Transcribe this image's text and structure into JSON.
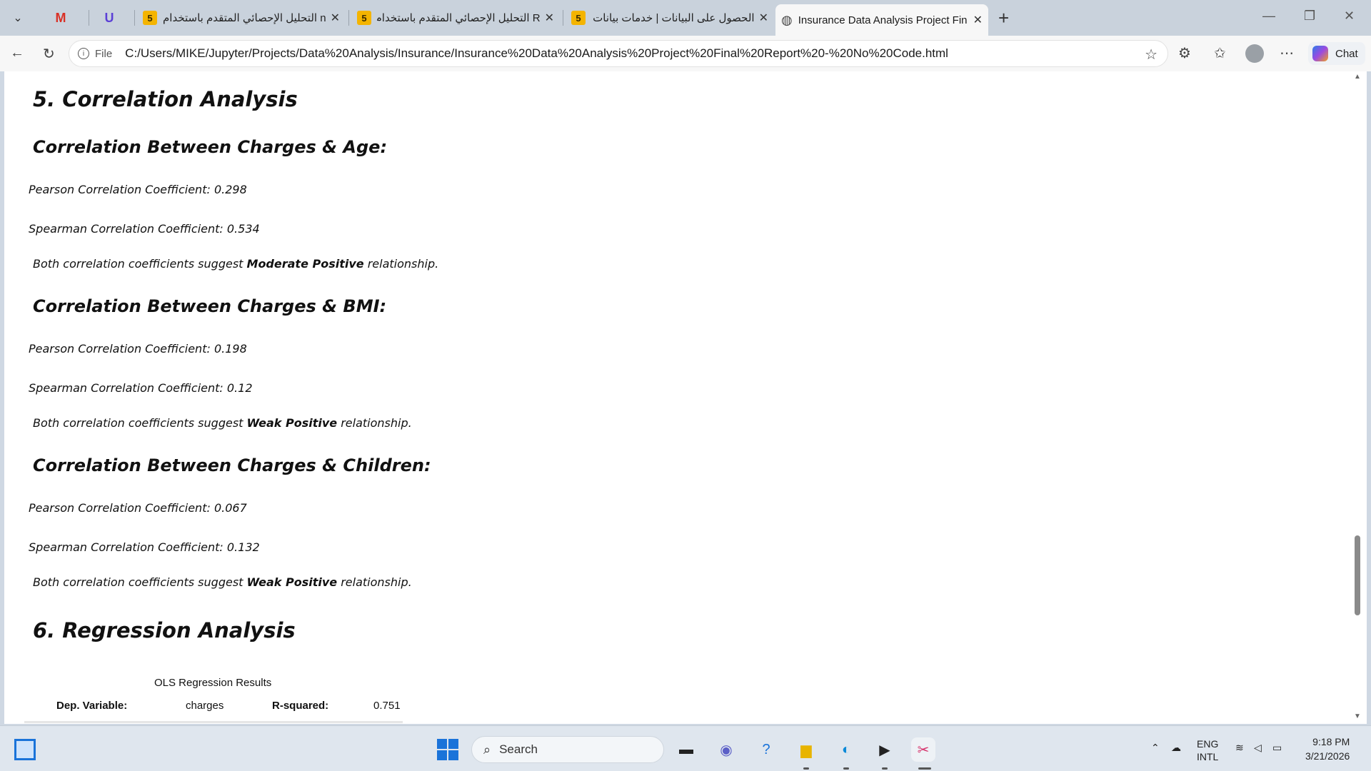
{
  "browser": {
    "pinned": [
      "M",
      "U"
    ],
    "tabs": [
      {
        "badge": "5",
        "title": "n التحليل الإحصائي المتقدم باستخدام"
      },
      {
        "badge": "5",
        "title": "R التحليل الإحصائي المتقدم باستخدام"
      },
      {
        "badge": "5",
        "title": "الحصول على البيانات | خدمات بيانات"
      },
      {
        "badge": "",
        "title": "Insurance Data Analysis Project Fin"
      }
    ],
    "protocol": "File",
    "url": "C:/Users/MIKE/Jupyter/Projects/Data%20Analysis/Insurance/Insurance%20Data%20Analysis%20Project%20Final%20Report%20-%20No%20Code.html",
    "chat_label": "Chat"
  },
  "report": {
    "section5_title": "5. Correlation Analysis",
    "age": {
      "heading": "Correlation Between Charges & Age:",
      "pearson": "Pearson Correlation Coefficient: 0.298",
      "spearman": "Spearman Correlation Coefficient: 0.534",
      "summary_prefix": "Both correlation coefficients suggest ",
      "summary_strength": "Moderate Positive",
      "summary_suffix": " relationship."
    },
    "bmi": {
      "heading": "Correlation Between Charges & BMI:",
      "pearson": "Pearson Correlation Coefficient: 0.198",
      "spearman": "Spearman Correlation Coefficient: 0.12",
      "summary_prefix": "Both correlation coefficients suggest ",
      "summary_strength": "Weak Positive",
      "summary_suffix": " relationship."
    },
    "children": {
      "heading": "Correlation Between Charges & Children:",
      "pearson": "Pearson Correlation Coefficient: 0.067",
      "spearman": "Spearman Correlation Coefficient: 0.132",
      "summary_prefix": "Both correlation coefficients suggest ",
      "summary_strength": "Weak Positive",
      "summary_suffix": " relationship."
    },
    "section6_title": "6. Regression Analysis",
    "ols": {
      "caption": "OLS Regression Results",
      "dep_label": "Dep. Variable:",
      "dep_value": "charges",
      "r2_label": "R-squared:",
      "r2_value": "0.751"
    }
  },
  "taskbar": {
    "search_placeholder": "Search",
    "lang_top": "ENG",
    "lang_bottom": "INTL",
    "time": "9:18 PM",
    "date": "3/21/2026"
  }
}
